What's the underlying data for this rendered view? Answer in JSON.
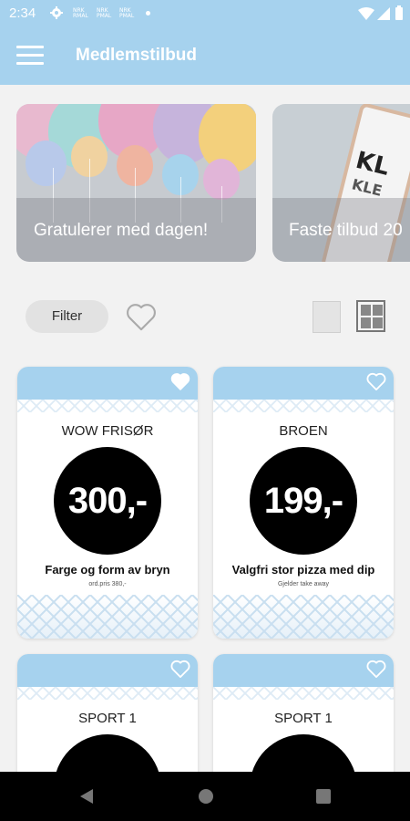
{
  "status_bar": {
    "time": "2:34",
    "notif_1": "NRK\nRMAL",
    "notif_2": "NRK\nPMAL",
    "notif_3": "NRK\nPMAL"
  },
  "app_bar": {
    "title": "Medlemstilbud"
  },
  "banners": [
    {
      "caption": "Gratulerer med dagen!"
    },
    {
      "caption": "Faste tilbud 20",
      "phone_text_1": "KL",
      "phone_text_2": "KLE"
    }
  ],
  "filter": {
    "label": "Filter"
  },
  "cards": [
    {
      "name": "WOW FRISØR",
      "price": "300,-",
      "description": "Farge og form av bryn",
      "note": "ord.pris 380,-"
    },
    {
      "name": "BROEN",
      "price": "199,-",
      "description": "Valgfri stor pizza med dip",
      "note": "Gjelder take away"
    },
    {
      "name": "SPORT 1"
    },
    {
      "name": "SPORT 1"
    }
  ],
  "colors": {
    "accent": "#a6d2ee",
    "background": "#f2f2f2",
    "price_circle": "#000000",
    "navbar": "#000000"
  },
  "icons": {
    "menu": "hamburger-icon",
    "favorite": "heart-outline-icon",
    "view_single": "single-view-icon",
    "view_grid": "grid-view-icon",
    "back": "back-triangle-icon",
    "home": "home-circle-icon",
    "recents": "recents-square-icon"
  }
}
